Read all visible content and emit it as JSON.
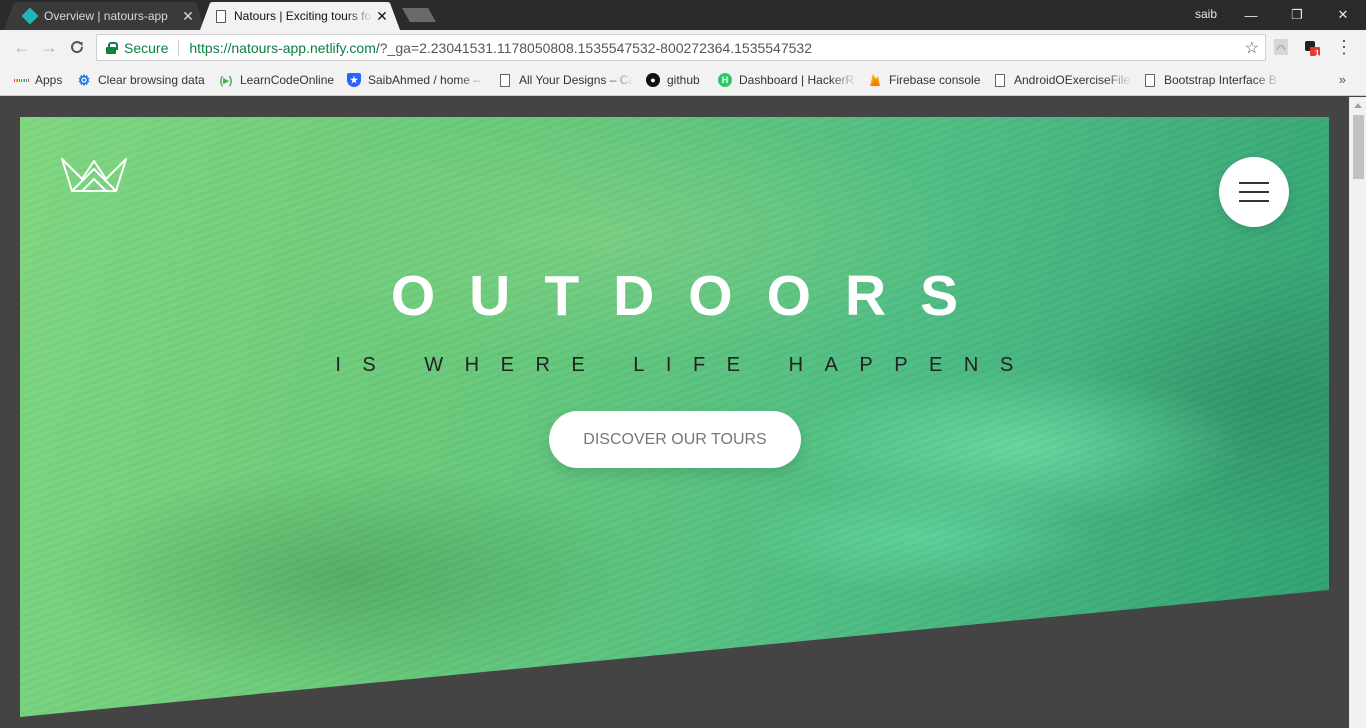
{
  "browser": {
    "tabs": [
      {
        "title": "Overview | natours-app",
        "active": false,
        "icon": "netlify-diamond-icon"
      },
      {
        "title": "Natours | Exciting tours fo",
        "active": true,
        "icon": "page-icon"
      }
    ],
    "user": "saib",
    "window_controls": {
      "minimize": "—",
      "restore": "❐",
      "close": "✕"
    },
    "address": {
      "secure_label": "Secure",
      "url_scheme_host": "https://natours-app.netlify.com",
      "url_rest": "/?_ga=2.23041531.1178050808.1535547532-800272364.1535547532"
    },
    "extension_badge": "1",
    "bookmarks": [
      {
        "label": "Apps",
        "icon": "apps-grid-icon"
      },
      {
        "label": "Clear browsing data",
        "icon": "gear-icon",
        "color": "#1a73e8"
      },
      {
        "label": "LearnCodeOnline",
        "icon": "lco-icon",
        "color": "#4caf50"
      },
      {
        "label": "SaibAhmed / home –",
        "icon": "shield-icon",
        "color": "#2962ff"
      },
      {
        "label": "All Your Designs – Ca",
        "icon": "page-icon"
      },
      {
        "label": "github",
        "icon": "github-icon",
        "color": "#111111"
      },
      {
        "label": "Dashboard | HackerR",
        "icon": "hackerrank-icon",
        "color": "#2ec866"
      },
      {
        "label": "Firebase console",
        "icon": "firebase-icon",
        "color": "#ffa000"
      },
      {
        "label": "AndroidOExerciseFile",
        "icon": "page-icon"
      },
      {
        "label": "Bootstrap Interface B",
        "icon": "page-icon"
      }
    ],
    "more_bookmarks": "»"
  },
  "page": {
    "brand_color": "#55c57a",
    "heading_main": "OUTDOORS",
    "heading_sub": "IS WHERE LIFE HAPPENS",
    "cta_label": "DISCOVER OUR TOURS"
  }
}
